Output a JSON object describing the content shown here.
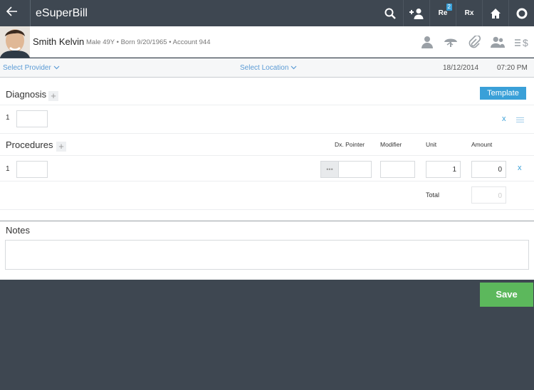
{
  "app": {
    "title": "eSuperBill"
  },
  "top_icons": [
    {
      "name": "search-icon"
    },
    {
      "name": "add-user-icon"
    },
    {
      "name": "reports-icon",
      "label": "Re",
      "badge": "2"
    },
    {
      "name": "rx-icon",
      "label": "Rx"
    },
    {
      "name": "home-icon"
    },
    {
      "name": "settings-icon"
    }
  ],
  "patient": {
    "name": "Smith Kelvin",
    "gender_age": "Male 49Y",
    "born": "Born 9/20/1965",
    "account": "Account 944",
    "actions": [
      "profile-icon",
      "insurance-umbrella-icon",
      "attachment-icon",
      "family-icon",
      "billing-icon"
    ]
  },
  "selectors": {
    "provider": "Select Provider",
    "location": "Select Location",
    "date": "18/12/2014",
    "time": "07:20 PM"
  },
  "diagnosis": {
    "title": "Diagnosis",
    "template_label": "Template",
    "rows": [
      {
        "num": "1",
        "code": ""
      }
    ],
    "remove_label": "x"
  },
  "procedures": {
    "title": "Procedures",
    "columns": {
      "pointer": "Dx. Pointer",
      "modifier": "Modifier",
      "unit": "Unit",
      "amount": "Amount"
    },
    "rows": [
      {
        "num": "1",
        "code": "",
        "pointer_dots": "•••",
        "pointer": "",
        "modifier": "",
        "unit": "1",
        "amount": "0"
      }
    ],
    "remove_label": "x",
    "total_label": "Total",
    "total_value": "0"
  },
  "notes": {
    "title": "Notes",
    "value": ""
  },
  "save_label": "Save",
  "colors": {
    "header": "#3e4751",
    "accent": "#3aa0d8",
    "save": "#5cb85c",
    "link": "#5b9bd5"
  }
}
